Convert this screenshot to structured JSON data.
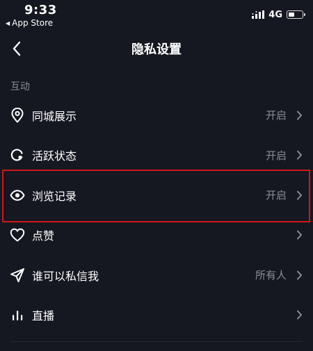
{
  "status_bar": {
    "time": "9:33",
    "back_app": "App Store",
    "network": "4G"
  },
  "nav": {
    "title": "隐私设置"
  },
  "section": {
    "title": "互动"
  },
  "rows": [
    {
      "label": "同城展示",
      "value": "开启",
      "icon": "location-pin-icon"
    },
    {
      "label": "活跃状态",
      "value": "开启",
      "icon": "active-status-icon"
    },
    {
      "label": "浏览记录",
      "value": "开启",
      "icon": "eye-icon"
    },
    {
      "label": "点赞",
      "value": "",
      "icon": "heart-icon"
    },
    {
      "label": "谁可以私信我",
      "value": "所有人",
      "icon": "send-icon"
    },
    {
      "label": "直播",
      "value": "",
      "icon": "live-bars-icon"
    }
  ],
  "colors": {
    "background": "#161821",
    "text": "#ffffff",
    "secondary_text": "#8b8d96",
    "highlight": "#d0161b"
  }
}
